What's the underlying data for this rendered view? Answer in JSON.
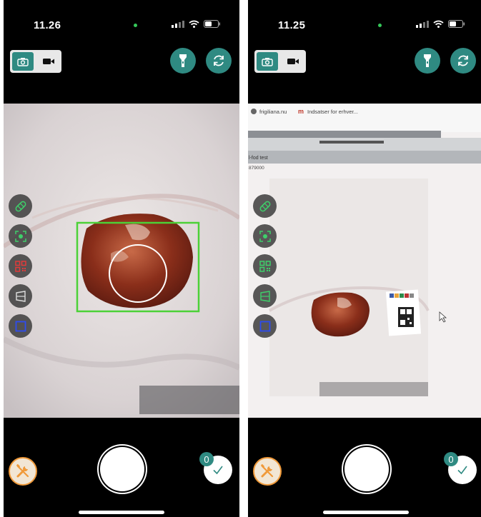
{
  "screens": [
    {
      "id": "left",
      "status_time": "11.26",
      "capture_count": "0"
    },
    {
      "id": "right",
      "status_time": "11.25",
      "capture_count": "0",
      "browser": {
        "tab1": "frigiliana.nu",
        "tab2_logo": "m",
        "tab2": "Indsatser for erhver...",
        "field_label": "l-fod test",
        "field_value": "879000"
      }
    }
  ],
  "colors": {
    "accent_teal": "#2f8a82",
    "detection_box": "#4cd137",
    "settings_orange": "#f09a3a",
    "wound": "#8a2e1a"
  },
  "icons": {
    "mode": [
      "camera-icon",
      "video-icon"
    ],
    "top_actions": [
      "flashlight-icon",
      "switch-camera-icon"
    ],
    "tools": [
      "bandage-icon",
      "focus-icon",
      "qr-code-icon",
      "shape-icon",
      "square-icon"
    ],
    "bottom": [
      "tools-icon",
      "shutter-button",
      "checkmark-icon"
    ]
  }
}
